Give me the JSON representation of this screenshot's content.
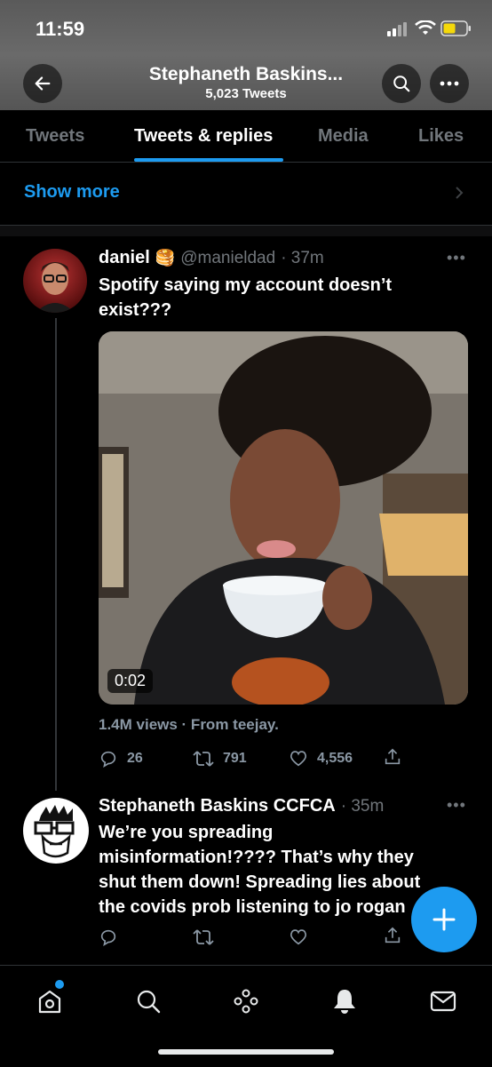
{
  "status_bar": {
    "time": "11:59",
    "icons": [
      "signal-icon",
      "wifi-icon",
      "battery-icon"
    ],
    "battery_color": "#f5d90a"
  },
  "header": {
    "title": "Stephaneth Baskins...",
    "subtitle": "5,023 Tweets",
    "back_icon": "arrow-left-icon",
    "search_icon": "search-icon",
    "more_icon": "more-icon"
  },
  "tabs": [
    {
      "label": "Tweets",
      "active": false
    },
    {
      "label": "Tweets & replies",
      "active": true
    },
    {
      "label": "Media",
      "active": false
    },
    {
      "label": "Likes",
      "active": false
    }
  ],
  "show_more": {
    "label": "Show more",
    "icon": "chevron-right-icon"
  },
  "tweets": [
    {
      "name": "daniel",
      "badge": "🥞",
      "handle": "@manieldad",
      "time": "· 37m",
      "text": "Spotify saying my account doesn’t exist???",
      "video_duration": "0:02",
      "views": "1.4M views · From teejay.",
      "replies": "26",
      "retweets": "791",
      "likes": "4,556"
    },
    {
      "name": "Stephaneth Baskins CCFCA",
      "time": "· 35m",
      "text": "We’re you spreading misinformation!???? That’s why they shut them down! Spreading lies about the covids prob listening to jo rogan"
    }
  ],
  "fab": {
    "icon": "plus-icon"
  },
  "bottom_nav": [
    {
      "icon": "home-icon",
      "has_dot": true
    },
    {
      "icon": "search-icon"
    },
    {
      "icon": "spaces-icon"
    },
    {
      "icon": "bell-icon"
    },
    {
      "icon": "mail-icon"
    }
  ],
  "colors": {
    "accent": "#1d9bf0",
    "background": "#000000",
    "muted": "#71767b"
  }
}
